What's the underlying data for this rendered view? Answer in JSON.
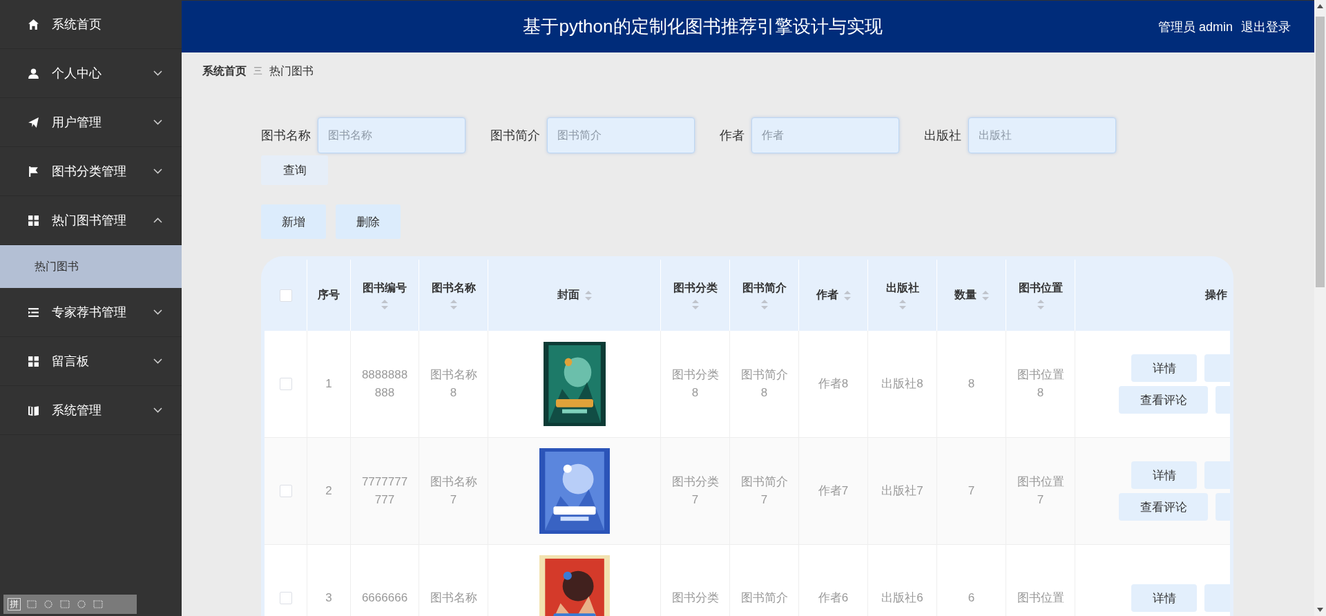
{
  "sidebar": {
    "items": [
      {
        "label": "系统首页"
      },
      {
        "label": "个人中心",
        "expanded": false
      },
      {
        "label": "用户管理",
        "expanded": false
      },
      {
        "label": "图书分类管理",
        "expanded": false
      },
      {
        "label": "热门图书管理",
        "expanded": true,
        "children": [
          {
            "label": "热门图书",
            "selected": true
          }
        ]
      },
      {
        "label": "专家荐书管理",
        "expanded": false
      },
      {
        "label": "留言板",
        "expanded": false
      },
      {
        "label": "系统管理",
        "expanded": false
      }
    ]
  },
  "header": {
    "title": "基于python的定制化图书推荐引擎设计与实现",
    "user": "管理员 admin",
    "logout": "退出登录"
  },
  "breadcrumb": {
    "home": "系统首页",
    "separator": "三",
    "current": "热门图书"
  },
  "filters": [
    {
      "label": "图书名称",
      "placeholder": "图书名称"
    },
    {
      "label": "图书简介",
      "placeholder": "图书简介"
    },
    {
      "label": "作者",
      "placeholder": "作者"
    },
    {
      "label": "出版社",
      "placeholder": "出版社"
    }
  ],
  "search_button": "查询",
  "buttons": [
    "新增",
    "删除"
  ],
  "table": {
    "select_all": false,
    "columns": [
      {
        "label": "序号",
        "sortable": false
      },
      {
        "label": "图书编号",
        "sortable": true
      },
      {
        "label": "图书名称",
        "sortable": true
      },
      {
        "label": "封面",
        "sortable": true
      },
      {
        "label": "图书分类",
        "sortable": true
      },
      {
        "label": "图书简介",
        "sortable": true
      },
      {
        "label": "作者",
        "sortable": true
      },
      {
        "label": "出版社",
        "sortable": true
      },
      {
        "label": "数量",
        "sortable": true
      },
      {
        "label": "图书位置",
        "sortable": true
      },
      {
        "label": "操作",
        "sortable": false
      }
    ],
    "rows": [
      {
        "checked": false,
        "index": "1",
        "book_no": "8888888888",
        "name": "图书名称8",
        "cover": {
          "kind": "picture"
        },
        "category": "图书分类8",
        "intro": "图书简介8",
        "author": "作者8",
        "publisher": "出版社8",
        "quantity": "8",
        "location": "图书位置8",
        "actions": [
          "详情",
          "查看评论"
        ]
      },
      {
        "checked": false,
        "index": "2",
        "book_no": "7777777777",
        "name": "图书名称7",
        "cover": {
          "kind": "picture"
        },
        "category": "图书分类7",
        "intro": "图书简介7",
        "author": "作者7",
        "publisher": "出版社7",
        "quantity": "7",
        "location": "图书位置7",
        "actions": [
          "详情",
          "查看评论"
        ]
      },
      {
        "checked": false,
        "index": "3",
        "book_no": "6666666",
        "name": "图书名称",
        "cover": {
          "kind": "picture"
        },
        "category": "图书分类",
        "intro": "图书简介",
        "author": "作者6",
        "publisher": "出版社6",
        "quantity": "6",
        "location": "图书位置",
        "actions": [
          "详情"
        ]
      }
    ]
  },
  "ime_toolbar": {
    "label": "拼"
  }
}
